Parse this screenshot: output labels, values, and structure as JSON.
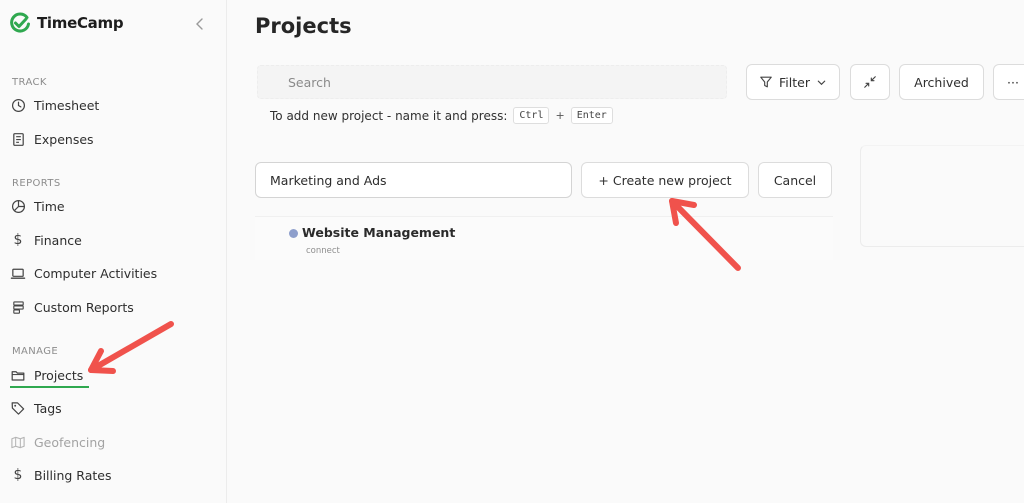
{
  "brand": {
    "name": "TimeCamp",
    "accent": "#2fa84f"
  },
  "sidebar": {
    "sections": [
      {
        "title": "TRACK",
        "items": [
          {
            "label": "Timesheet",
            "icon": "clock-icon"
          },
          {
            "label": "Expenses",
            "icon": "receipt-icon"
          }
        ]
      },
      {
        "title": "REPORTS",
        "items": [
          {
            "label": "Time",
            "icon": "pie-chart-icon"
          },
          {
            "label": "Finance",
            "icon": "dollar-icon"
          },
          {
            "label": "Computer Activities",
            "icon": "laptop-icon"
          },
          {
            "label": "Custom Reports",
            "icon": "stack-icon"
          }
        ]
      },
      {
        "title": "MANAGE",
        "items": [
          {
            "label": "Projects",
            "icon": "folder-icon",
            "active": true
          },
          {
            "label": "Tags",
            "icon": "tag-icon"
          },
          {
            "label": "Geofencing",
            "icon": "map-icon",
            "disabled": true
          },
          {
            "label": "Billing Rates",
            "icon": "dollar-icon"
          }
        ]
      }
    ]
  },
  "main": {
    "title": "Projects",
    "search": {
      "placeholder": "Search",
      "value": ""
    },
    "toolbar": {
      "filter_label": "Filter",
      "archived_label": "Archived",
      "more_label": "···"
    },
    "hint": {
      "text": "To add new project - name it and press:",
      "key1": "Ctrl",
      "plus": "+",
      "key2": "Enter"
    },
    "new_project": {
      "value": "Marketing and Ads",
      "create_label": "+ Create new project",
      "cancel_label": "Cancel"
    },
    "projects": [
      {
        "name": "Website Management",
        "subtitle": "connect",
        "color": "#8e9fcc"
      }
    ]
  },
  "annotation_color": "#f0524c"
}
